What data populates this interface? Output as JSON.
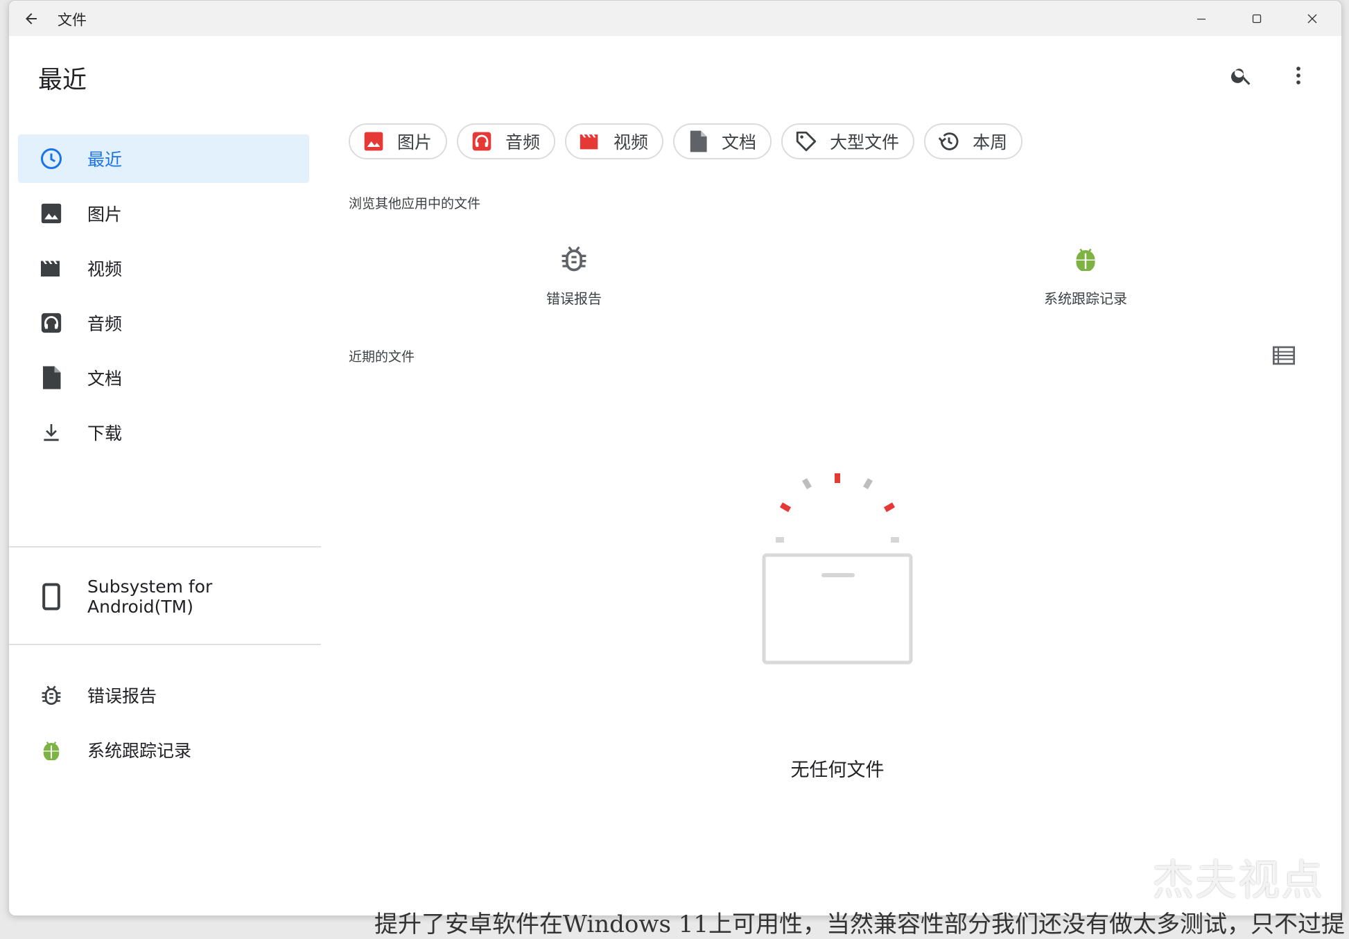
{
  "window": {
    "title": "文件",
    "colors": {
      "accent": "#1a73e8",
      "active_bg": "#e3f1fd",
      "red_icon": "#e53935",
      "android_green": "#7cb342"
    }
  },
  "header": {
    "title": "最近",
    "search_icon": "search-icon",
    "more_icon": "more-vert-icon"
  },
  "sidebar": {
    "items": [
      {
        "label": "最近",
        "icon": "clock-icon",
        "active": true
      },
      {
        "label": "图片",
        "icon": "image-icon"
      },
      {
        "label": "视频",
        "icon": "movie-icon"
      },
      {
        "label": "音频",
        "icon": "headphones-icon"
      },
      {
        "label": "文档",
        "icon": "document-icon"
      },
      {
        "label": "下载",
        "icon": "download-icon"
      }
    ],
    "device": {
      "label": "Subsystem for Android(TM)",
      "icon": "phone-icon"
    },
    "apps": [
      {
        "label": "错误报告",
        "icon": "bug-icon"
      },
      {
        "label": "系统跟踪记录",
        "icon": "android-icon"
      }
    ]
  },
  "chips": [
    {
      "label": "图片",
      "icon": "image-icon"
    },
    {
      "label": "音频",
      "icon": "headphones-icon"
    },
    {
      "label": "视频",
      "icon": "movie-icon"
    },
    {
      "label": "文档",
      "icon": "document-icon"
    },
    {
      "label": "大型文件",
      "icon": "tag-icon"
    },
    {
      "label": "本周",
      "icon": "history-icon"
    }
  ],
  "browse": {
    "label": "浏览其他应用中的文件",
    "apps": [
      {
        "label": "错误报告",
        "icon": "bug-icon"
      },
      {
        "label": "系统跟踪记录",
        "icon": "android-icon"
      }
    ]
  },
  "recent": {
    "label": "近期的文件",
    "view_icon": "list-view-icon",
    "empty_text": "无任何文件"
  },
  "overlay": {
    "caption": "提升了安卓软件在Windows 11上可用性，当然兼容性部分我们还没有做太多测试，只不过提",
    "watermark": "杰夫视点"
  }
}
